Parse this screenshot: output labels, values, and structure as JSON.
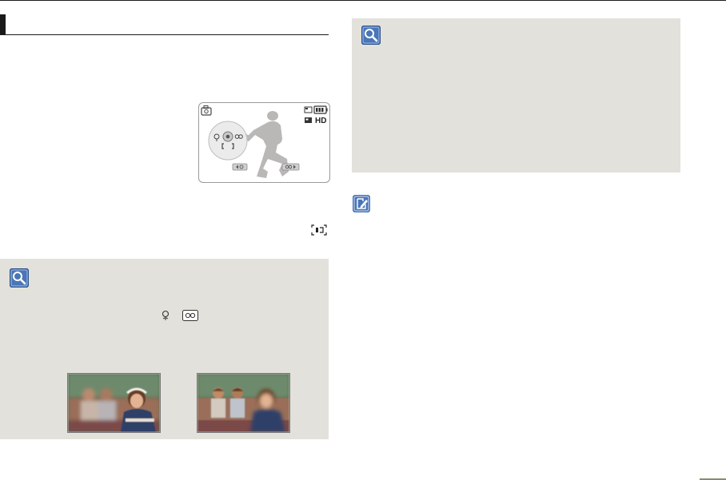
{
  "lcd": {
    "hd_label": "HD"
  },
  "icons": {
    "tip_icon": "magnifier-icon",
    "note_icon": "pencil-note-icon",
    "focus_mode_icon": "manual-focus-frame-icon",
    "macro_icon": "flower-macro-icon",
    "infinity_icon": "infinity-focus-icon"
  },
  "colors": {
    "panel": "#e3e1db",
    "icon_blue": "#4a76b8",
    "page_marker": "#8a8a72"
  }
}
